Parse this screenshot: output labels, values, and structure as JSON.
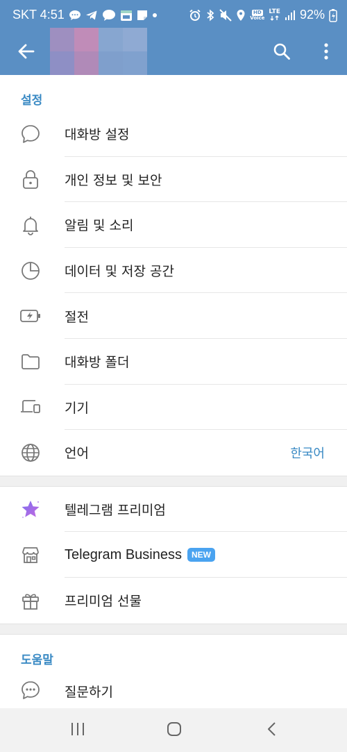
{
  "status_bar": {
    "carrier_time": "SKT 4:51",
    "hd_label": "HD",
    "voice_label": "Voice",
    "lte_label": "LTE",
    "battery": "92%",
    "talk_label": "TALK"
  },
  "app_bar": {
    "back_icon": "arrow-left-icon",
    "search_icon": "search-icon",
    "menu_icon": "more-vertical-icon"
  },
  "sections": {
    "settings": {
      "header": "설정",
      "items": [
        {
          "label": "대화방 설정",
          "icon": "chat-bubble-icon"
        },
        {
          "label": "개인 정보 및 보안",
          "icon": "lock-icon"
        },
        {
          "label": "알림 및 소리",
          "icon": "bell-icon"
        },
        {
          "label": "데이터 및 저장 공간",
          "icon": "pie-chart-icon"
        },
        {
          "label": "절전",
          "icon": "battery-bolt-icon"
        },
        {
          "label": "대화방 폴더",
          "icon": "folder-icon"
        },
        {
          "label": "기기",
          "icon": "devices-icon"
        },
        {
          "label": "언어",
          "value": "한국어",
          "icon": "globe-icon"
        }
      ]
    },
    "premium": {
      "items": [
        {
          "label": "텔레그램 프리미엄",
          "icon": "premium-star-icon"
        },
        {
          "label": "Telegram Business",
          "badge": "NEW",
          "icon": "store-icon"
        },
        {
          "label": "프리미엄 선물",
          "icon": "gift-icon"
        }
      ]
    },
    "help": {
      "header": "도움말",
      "items": [
        {
          "label": "질문하기",
          "icon": "chat-dots-icon"
        }
      ]
    }
  },
  "colors": {
    "app_bar": "#5a8fc4",
    "accent": "#3a8ac4",
    "badge": "#4aa3f0",
    "icon": "#777777"
  }
}
